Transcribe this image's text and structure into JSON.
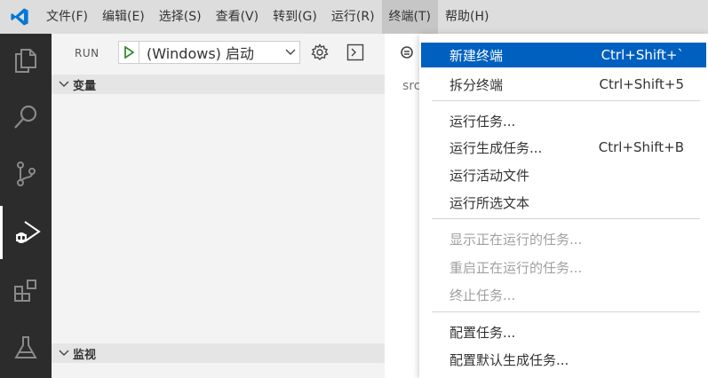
{
  "menubar": {
    "items": [
      "文件(F)",
      "编辑(E)",
      "选择(S)",
      "查看(V)",
      "转到(G)",
      "运行(R)",
      "终端(T)",
      "帮助(H)"
    ],
    "active_index": 6
  },
  "activity_bar": {
    "icons": [
      "files-icon",
      "search-icon",
      "source-control-icon",
      "run-debug-icon",
      "extensions-icon",
      "testing-icon"
    ],
    "active": "run-debug-icon"
  },
  "sidebar": {
    "run_label": "RUN",
    "launch_config": "(Windows) 启动",
    "variables_title": "变量",
    "watch_title": "监视"
  },
  "editor": {
    "partial_text": "src"
  },
  "terminal_menu": {
    "items": [
      {
        "label": "新建终端",
        "shortcut": "Ctrl+Shift+`",
        "state": "selected"
      },
      {
        "label": "拆分终端",
        "shortcut": "Ctrl+Shift+5",
        "state": "normal"
      },
      {
        "label": "运行任务...",
        "shortcut": "",
        "state": "normal"
      },
      {
        "label": "运行生成任务...",
        "shortcut": "Ctrl+Shift+B",
        "state": "normal"
      },
      {
        "label": "运行活动文件",
        "shortcut": "",
        "state": "normal"
      },
      {
        "label": "运行所选文本",
        "shortcut": "",
        "state": "normal"
      },
      {
        "label": "显示正在运行的任务...",
        "shortcut": "",
        "state": "disabled"
      },
      {
        "label": "重启正在运行的任务...",
        "shortcut": "",
        "state": "disabled"
      },
      {
        "label": "终止任务...",
        "shortcut": "",
        "state": "disabled"
      },
      {
        "label": "配置任务...",
        "shortcut": "",
        "state": "normal"
      },
      {
        "label": "配置默认生成任务...",
        "shortcut": "",
        "state": "normal"
      }
    ]
  },
  "colors": {
    "accent": "#0060c0",
    "vscode_blue": "#0078d4",
    "activity_bg": "#2c2c2c",
    "run_green": "#388a34"
  }
}
